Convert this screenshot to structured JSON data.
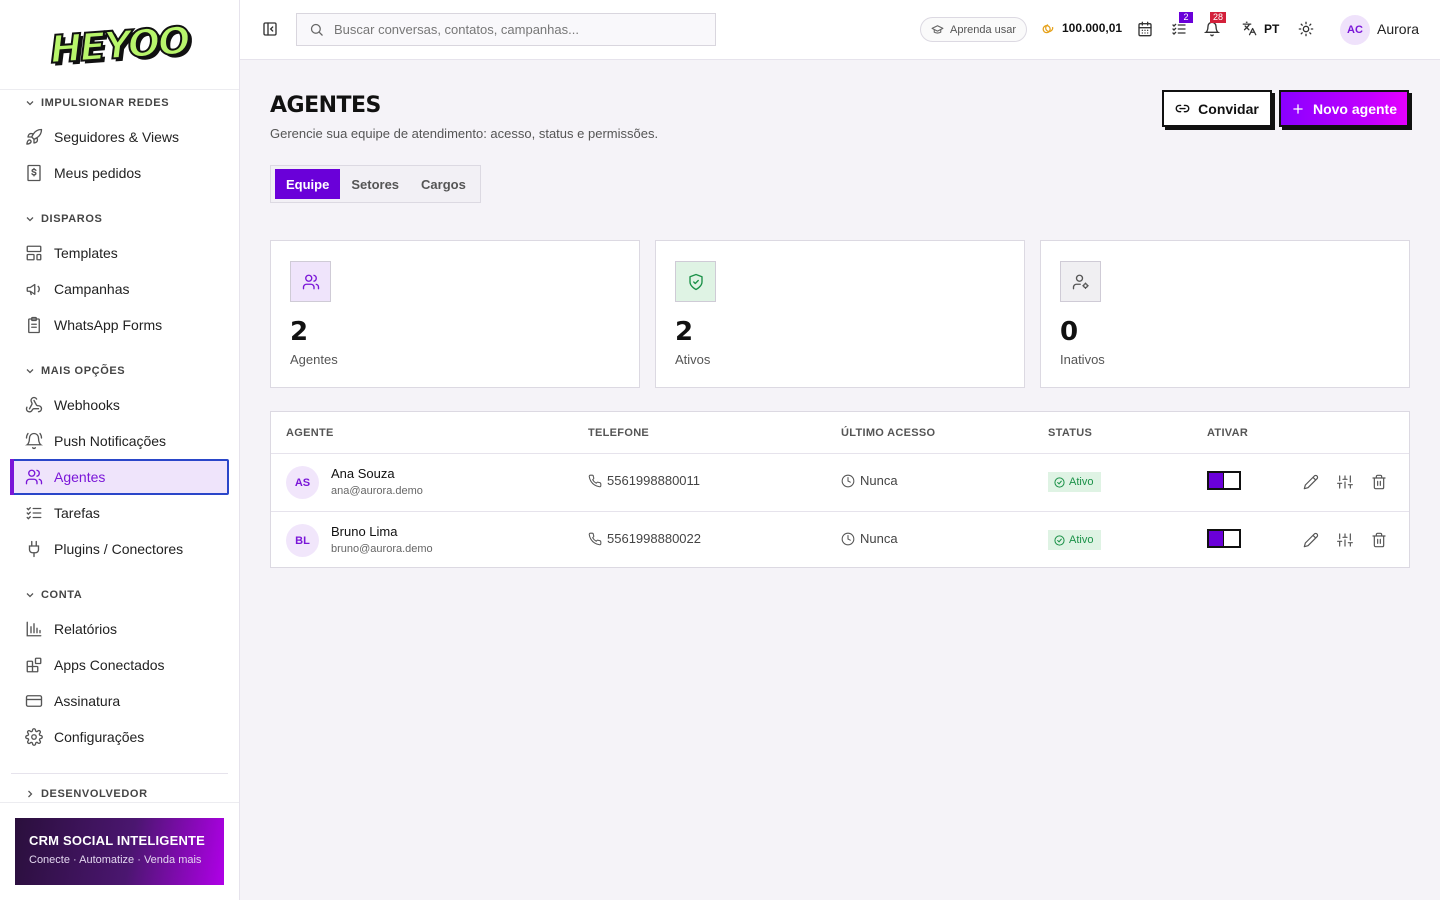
{
  "brand": {
    "logo_text": "HEYOO"
  },
  "sidebar": {
    "sections": [
      {
        "title": "IMPULSIONAR REDES",
        "items": [
          "Seguidores & Views",
          "Meus pedidos"
        ]
      },
      {
        "title": "DISPAROS",
        "items": [
          "Templates",
          "Campanhas",
          "WhatsApp Forms"
        ]
      },
      {
        "title": "MAIS OPÇÕES",
        "items": [
          "Webhooks",
          "Push Notificações",
          "Agentes",
          "Tarefas",
          "Plugins / Conectores"
        ]
      },
      {
        "title": "CONTA",
        "items": [
          "Relatórios",
          "Apps Conectados",
          "Assinatura",
          "Configurações"
        ]
      },
      {
        "title": "DESENVOLVEDOR",
        "items": []
      }
    ],
    "active_item": "Agentes",
    "promo": {
      "title": "CRM SOCIAL INTELIGENTE",
      "subtitle": "Conecte · Automatize · Venda mais"
    }
  },
  "topbar": {
    "search_placeholder": "Buscar conversas, contatos, campanhas...",
    "learn_label": "Aprenda usar",
    "credits": "100.000,01",
    "tasks_badge": "2",
    "notifications_badge": "28",
    "language": "PT",
    "user_initials": "AC",
    "user_name": "Aurora"
  },
  "page": {
    "title": "AGENTES",
    "subtitle": "Gerencie sua equipe de atendimento: acesso, status e permissões.",
    "invite_label": "Convidar",
    "new_label": "Novo agente",
    "tabs": [
      "Equipe",
      "Setores",
      "Cargos"
    ],
    "active_tab": "Equipe"
  },
  "stats": [
    {
      "value": "2",
      "label": "Agentes",
      "icon": "users-icon",
      "color": "#7a16d8",
      "bg": "#efe4fb"
    },
    {
      "value": "2",
      "label": "Ativos",
      "icon": "shield-check-icon",
      "color": "#1b9148",
      "bg": "#dff3e4"
    },
    {
      "value": "0",
      "label": "Inativos",
      "icon": "user-cog-icon",
      "color": "#555555",
      "bg": "#f0eff2"
    }
  ],
  "table": {
    "headers": [
      "AGENTE",
      "TELEFONE",
      "ÚLTIMO ACESSO",
      "STATUS",
      "ATIVAR"
    ],
    "rows": [
      {
        "initials": "AS",
        "name": "Ana Souza",
        "email": "ana@aurora.demo",
        "phone": "5561998880011",
        "last_access": "Nunca",
        "status": "Ativo",
        "enabled": true
      },
      {
        "initials": "BL",
        "name": "Bruno Lima",
        "email": "bruno@aurora.demo",
        "phone": "5561998880022",
        "last_access": "Nunca",
        "status": "Ativo",
        "enabled": true
      }
    ]
  },
  "colors": {
    "accent": "#6a00d9",
    "active_nav": "#7a16d8",
    "success": "#1b9148"
  }
}
